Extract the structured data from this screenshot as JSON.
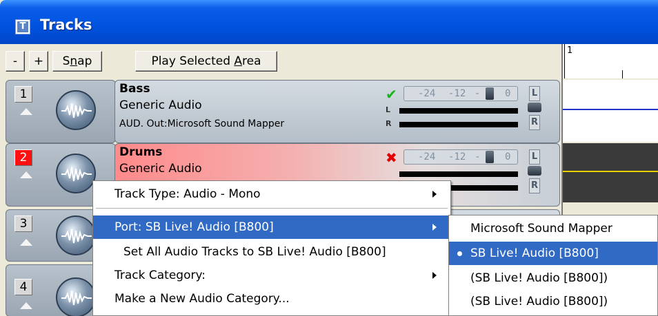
{
  "window": {
    "title": "Tracks",
    "icon": "tracks-app-icon"
  },
  "toolbar": {
    "minus_label": "-",
    "plus_label": "+",
    "snap_label_pre": "S",
    "snap_label_u": "n",
    "snap_label_post": "ap",
    "play_label_pre": "Play Selected ",
    "play_label_u": "A",
    "play_label_post": "rea"
  },
  "ruler": {
    "start_label": "1"
  },
  "tracks": [
    {
      "number": "1",
      "name": "Bass",
      "type": "Generic Audio",
      "port": "AUD. Out:Microsoft Sound Mapper",
      "status_icon": "check-icon",
      "status_glyph": "✔",
      "selected": false
    },
    {
      "number": "2",
      "name": "Drums",
      "type": "Generic Audio",
      "status_icon": "x-icon",
      "status_glyph": "✖",
      "selected": true
    },
    {
      "number": "3"
    },
    {
      "number": "4"
    }
  ],
  "meter": {
    "m24": "-24",
    "m12": "-12",
    "mdash": "-",
    "m0": "0",
    "L": "L",
    "R": "R"
  },
  "context_menu": {
    "items": [
      {
        "label": "Track Type: Audio - Mono",
        "has_submenu": true
      },
      {
        "label": "Port: SB Live! Audio [B800]",
        "has_submenu": true,
        "highlighted": true
      },
      {
        "label": "Set All Audio Tracks to SB Live! Audio [B800]",
        "has_submenu": false
      },
      {
        "label": "Track Category:",
        "has_submenu": true
      },
      {
        "label": "Make a New Audio Category...",
        "has_submenu": false
      }
    ]
  },
  "port_submenu": {
    "items": [
      {
        "label": "Microsoft Sound Mapper",
        "selected": false
      },
      {
        "label": "SB Live! Audio [B800]",
        "selected": true
      },
      {
        "label": "(SB Live! Audio [B800])",
        "selected": false
      },
      {
        "label": "(SB Live! Audio [B800])",
        "selected": false
      }
    ]
  },
  "colors": {
    "titlebar": "#0052de",
    "highlight": "#316ac5",
    "selected_track": "#ff1010",
    "lane_line_1": "#2030c8",
    "lane_line_2": "#e8d000"
  }
}
